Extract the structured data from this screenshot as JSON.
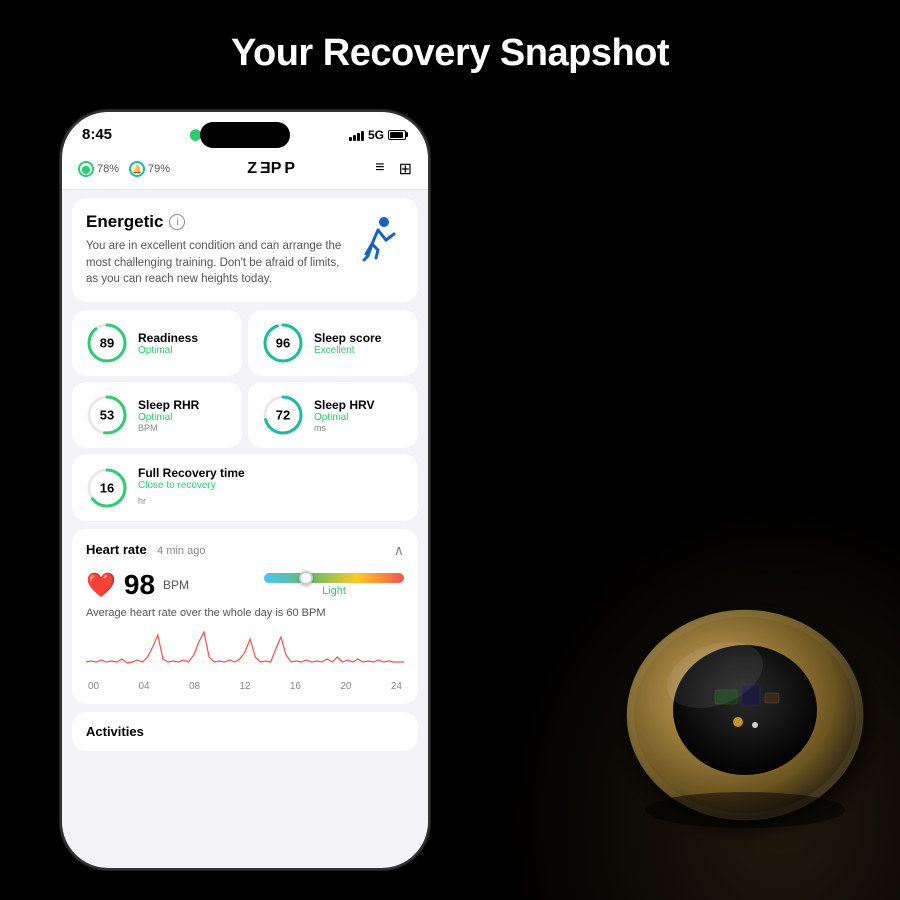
{
  "page": {
    "title": "Your Recovery Snapshot",
    "background": "#000000"
  },
  "status_bar": {
    "time": "8:45",
    "left_indicators": [
      {
        "icon": "ring-icon",
        "value": "78%"
      },
      {
        "icon": "sleep-icon",
        "value": "79%"
      }
    ],
    "signal": "5G",
    "battery": "100"
  },
  "nav": {
    "logo": "ZEPP",
    "filter_icon": "≡↑",
    "grid_icon": "⊞"
  },
  "energetic_card": {
    "title": "Energetic",
    "description": "You are in excellent condition and can arrange the most challenging training. Don't be afraid of limits, as you can reach new heights today.",
    "icon": "running-person"
  },
  "metrics": [
    {
      "value": "89",
      "name": "Readiness",
      "status": "Optimal",
      "unit": "",
      "progress": 89,
      "color": "#2ecc71"
    },
    {
      "value": "96",
      "name": "Sleep score",
      "status": "Excellent",
      "unit": "",
      "progress": 96,
      "color": "#2ecc71"
    },
    {
      "value": "53",
      "name": "Sleep RHR",
      "status": "Optimal",
      "unit": "BPM",
      "progress": 53,
      "color": "#2ecc71"
    },
    {
      "value": "72",
      "name": "Sleep HRV",
      "status": "Optimal",
      "unit": "ms",
      "progress": 72,
      "color": "#2ecc71"
    }
  ],
  "recovery": {
    "value": "16",
    "unit": "hr",
    "name": "Full Recovery time",
    "status": "Close to recovery",
    "progress": 65,
    "color": "#2ecc71"
  },
  "heart_rate": {
    "section_title": "Heart rate",
    "time_ago": "4 min ago",
    "bpm": "98",
    "unit": "BPM",
    "zone": "Light",
    "avg_text": "Average heart rate over the whole day is 60 BPM",
    "x_labels": [
      "00",
      "04",
      "08",
      "12",
      "16",
      "20",
      "24"
    ]
  },
  "activities": {
    "title": "Activities"
  }
}
